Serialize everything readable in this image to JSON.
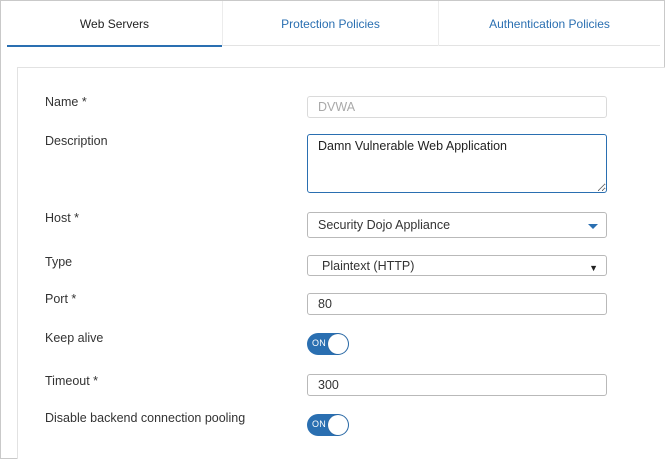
{
  "tabs": [
    {
      "label": "Web Servers",
      "active": true
    },
    {
      "label": "Protection Policies",
      "active": false
    },
    {
      "label": "Authentication Policies",
      "active": false
    }
  ],
  "form": {
    "name": {
      "label": "Name *",
      "value": "DVWA"
    },
    "description": {
      "label": "Description",
      "value": "Damn Vulnerable Web Application"
    },
    "host": {
      "label": "Host *",
      "value": "Security Dojo Appliance"
    },
    "type": {
      "label": "Type",
      "value": "Plaintext (HTTP)"
    },
    "port": {
      "label": "Port *",
      "value": "80"
    },
    "keep_alive": {
      "label": "Keep alive",
      "toggle_text": "ON",
      "enabled": true
    },
    "timeout": {
      "label": "Timeout *",
      "value": "300"
    },
    "pooling": {
      "label": "Disable backend connection pooling",
      "toggle_text": "ON",
      "enabled": true
    }
  },
  "colors": {
    "accent": "#2a6fb1",
    "border": "#b9b9b9",
    "disabled_text": "#a9a9a9"
  }
}
